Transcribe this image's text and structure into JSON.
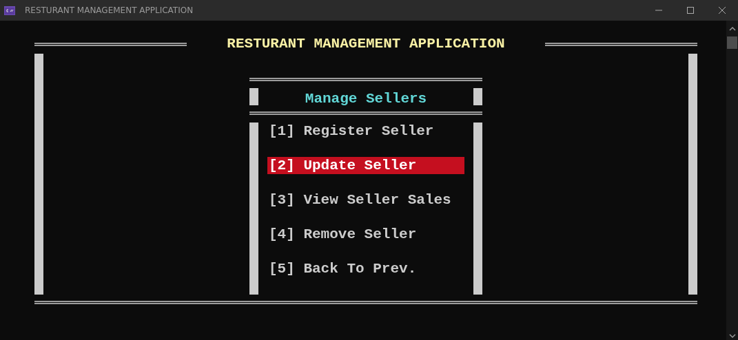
{
  "window": {
    "title": "RESTURANT MANAGEMENT APPLICATION"
  },
  "heading": "RESTURANT MANAGEMENT APPLICATION",
  "menu": {
    "title": "Manage Sellers",
    "items": [
      {
        "label": "[1] Register Seller",
        "selected": false
      },
      {
        "label": "[2] Update Seller",
        "selected": true
      },
      {
        "label": "[3] View Seller Sales",
        "selected": false
      },
      {
        "label": "[4] Remove Seller",
        "selected": false
      },
      {
        "label": "[5] Back To Prev.",
        "selected": false
      }
    ]
  }
}
